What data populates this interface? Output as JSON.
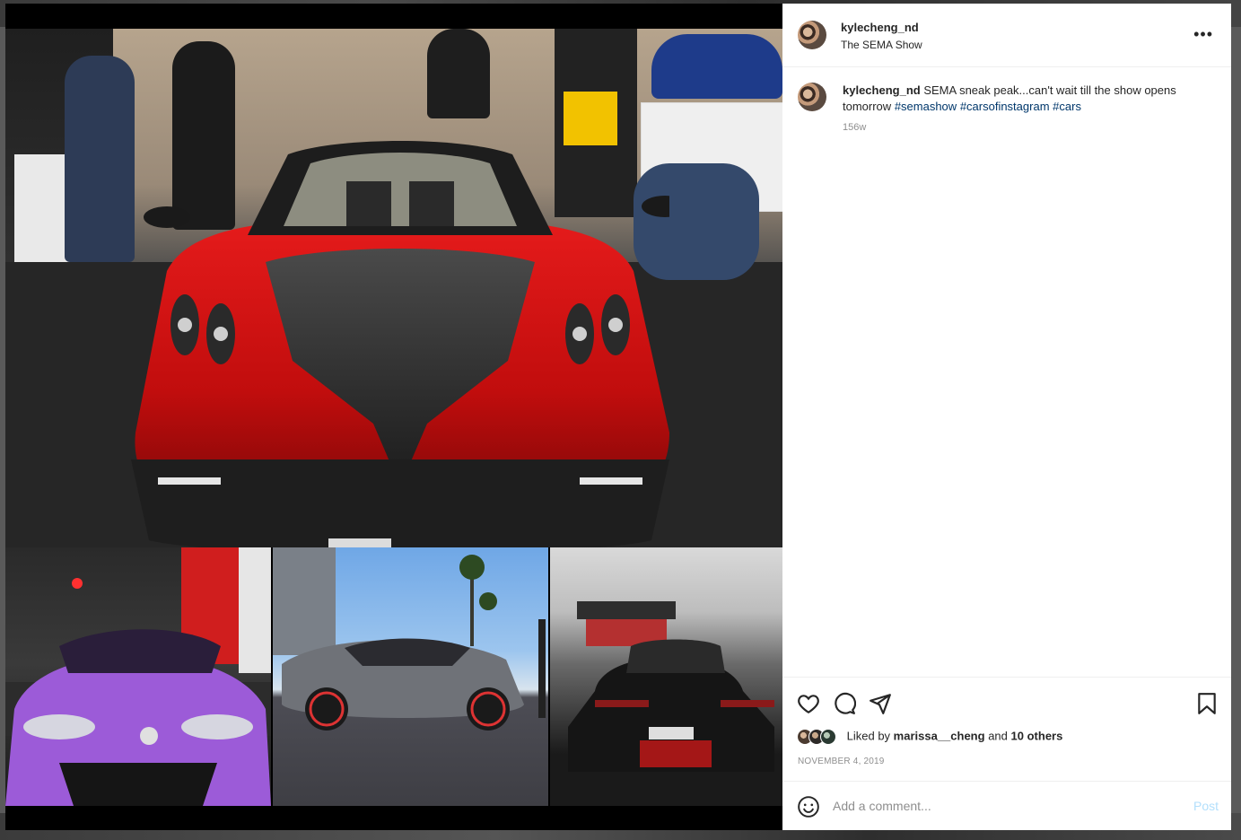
{
  "header": {
    "username": "kylecheng_nd",
    "location": "The SEMA Show",
    "more_label": "•••"
  },
  "caption": {
    "username": "kylecheng_nd",
    "text_before": "SEMA sneak peak...can't wait till the show opens tomorrow",
    "hashtags": [
      "#semashow",
      "#carsofinstagram",
      "#cars"
    ],
    "age": "156w"
  },
  "actions": {
    "icons": [
      "heart-icon",
      "comment-icon",
      "share-icon",
      "bookmark-icon"
    ]
  },
  "likes": {
    "prefix": "Liked by",
    "user": "marissa__cheng",
    "connector": "and",
    "others": "10 others"
  },
  "date": "NOVEMBER 4, 2019",
  "comment_box": {
    "placeholder": "Add a comment...",
    "post_label": "Post"
  },
  "colors": {
    "link": "#00376b",
    "post_disabled": "#b2dffc",
    "car_red": "#c81010",
    "car_purple": "#9c5bd8"
  }
}
